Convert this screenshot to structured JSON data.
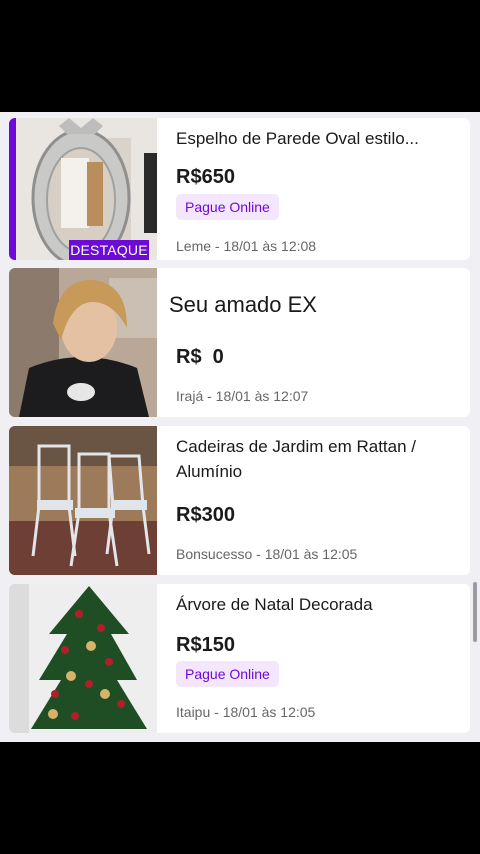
{
  "listings": [
    {
      "title": "Espelho de Parede Oval estilo...",
      "price": "R$650",
      "pay_label": "Pague Online",
      "badge": "DESTAQUE",
      "location_time": "Leme - 18/01 às 12:08",
      "image": "oval-mirror-photo"
    },
    {
      "title": "Seu amado EX",
      "price": "R$  0",
      "location_time": "Irajá - 18/01 às 12:07",
      "image": "person-photo"
    },
    {
      "title": "Cadeiras de Jardim em Rattan / Alumínio",
      "price": "R$300",
      "location_time": "Bonsucesso - 18/01 às 12:05",
      "image": "garden-chairs-photo"
    },
    {
      "title": "Árvore de Natal Decorada",
      "price": "R$150",
      "pay_label": "Pague Online",
      "location_time": "Itaipu - 18/01 às 12:05",
      "image": "christmas-tree-photo"
    }
  ],
  "colors": {
    "accent": "#6e0ad6",
    "pay_bg": "#f3e6fd"
  }
}
